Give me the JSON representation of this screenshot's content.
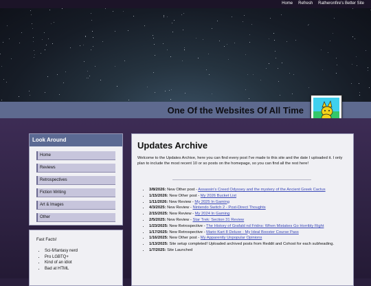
{
  "top_nav": [
    "Home",
    "Refresh",
    "Ratheronfire's Better Site"
  ],
  "site_title": "One Of the Websites Of All Time",
  "sidebar": {
    "header": "Look Around",
    "items": [
      "Home",
      "Reviews",
      "Retrospectives",
      "Fiction Writing",
      "Art & Images",
      "Other"
    ]
  },
  "fast_facts": {
    "title": "Fast Facts!",
    "items": [
      "Sci-fi/fantasy nerd",
      "Pro LGBTQ+",
      "Kind of an idiot",
      "Bad at HTML"
    ]
  },
  "main": {
    "title": "Updates Archive",
    "intro": "Welcome to the Updates Archive, here you can find every post I've made to this site and the date I uploaded it. I only plan to include the most recent 10 or so posts on the homepage, so you can find all the rest here!",
    "updates": [
      {
        "date": "3/8/2026:",
        "text": "New Other post - ",
        "link": "Assassin's Creed Odyssey and the mystery of the Ancient Greek Cactus"
      },
      {
        "date": "1/15/2026:",
        "text": "New Other post - ",
        "link": "My 2026 Bucket List"
      },
      {
        "date": "1/11/2026:",
        "text": "New Review - ",
        "link": "My 2025 In Gaming"
      },
      {
        "date": "4/3/2025:",
        "text": "New Review - ",
        "link": "Nintendo Switch 2 - Post-Direct Thoughts"
      },
      {
        "date": "2/15/2025:",
        "text": "New Review - ",
        "link": "My 2024 In Gaming"
      },
      {
        "date": "2/5/2025:",
        "text": "New Review - ",
        "link": "Star Trek: Section 31 Review"
      },
      {
        "date": "1/23/2025:",
        "text": "New Retrospective - ",
        "link": "The History of Grafald nd Fridns: When Mistakes Go Horribly Right"
      },
      {
        "date": "1/17/2025:",
        "text": "New Retrospective - ",
        "link": "Mario Kart 8 Deluxe - My Ideal Booster Course Pass"
      },
      {
        "date": "1/16/2025:",
        "text": "New Other post - ",
        "link": "My Apparently Unpopular Opinions"
      },
      {
        "date": "1/13/2025:",
        "text": "Site setup completed! Uploaded archived posts from Reddit and Cohost for each subheading.",
        "link": ""
      },
      {
        "date": "1/7/2025:",
        "text": "Site Launched",
        "link": ""
      }
    ]
  }
}
